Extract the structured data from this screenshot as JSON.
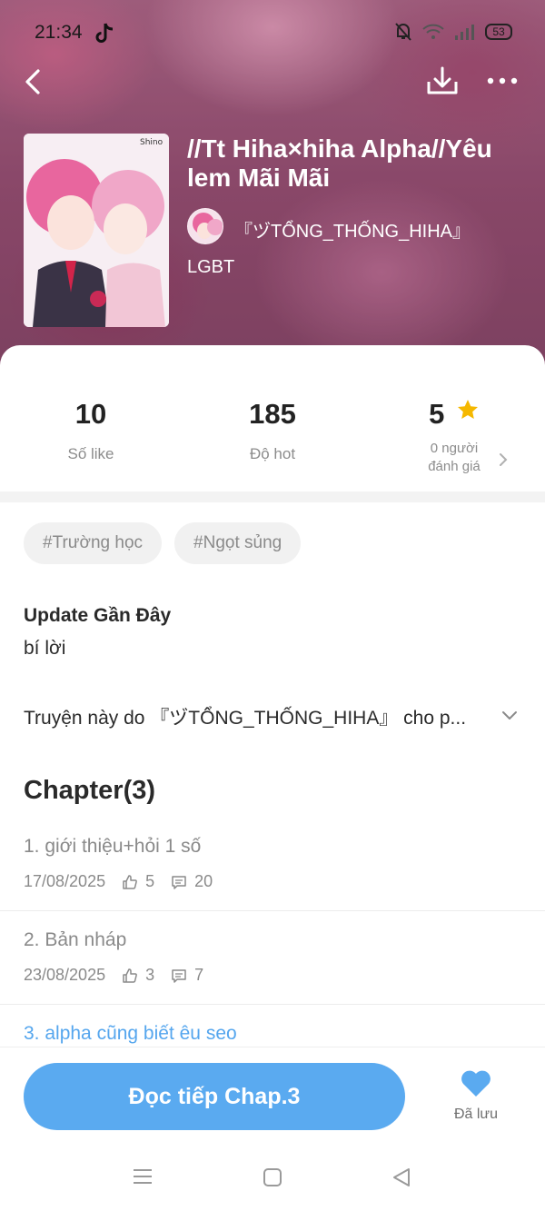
{
  "status_bar": {
    "time": "21:34",
    "battery": "53"
  },
  "book": {
    "title": "//Tt Hiha×hiha Alpha//Yêu lem Mãi Mãi",
    "author": "『ヅTỔNG_THỐNG_HIHA』",
    "genre": "LGBT",
    "cover_signature": "Shino"
  },
  "stats": {
    "likes": {
      "value": "10",
      "label": "Số like"
    },
    "hot": {
      "value": "185",
      "label": "Độ hot"
    },
    "rating": {
      "value": "5",
      "label_line1": "0 người",
      "label_line2": "đánh giá"
    }
  },
  "tags": [
    "#Trường học",
    "#Ngọt sủng"
  ],
  "update": {
    "heading": "Update Gần Đây",
    "text": "bí lời"
  },
  "description": "Truyện này do 『ヅTỔNG_THỐNG_HIHA』 cho p...",
  "chapters_heading": "Chapter(3)",
  "chapters": [
    {
      "title": "1. giới thiệu+hỏi 1 số",
      "date": "17/08/2025",
      "likes": "5",
      "comments": "20"
    },
    {
      "title": "2. Bản nháp",
      "date": "23/08/2025",
      "likes": "3",
      "comments": "7"
    },
    {
      "title": "3. alpha cũng biết êu seo"
    }
  ],
  "actions": {
    "read_label": "Đọc tiếp Chap.3",
    "save_label": "Đã lưu"
  },
  "colors": {
    "accent": "#5aaaf0",
    "star": "#f5b800"
  },
  "icons": [
    "back-icon",
    "download-icon",
    "more-icon",
    "star-icon",
    "chevron-right-icon",
    "chevron-down-icon",
    "thumb-up-icon",
    "comment-icon",
    "heart-icon",
    "menu-icon",
    "home-square-icon",
    "back-triangle-icon"
  ]
}
